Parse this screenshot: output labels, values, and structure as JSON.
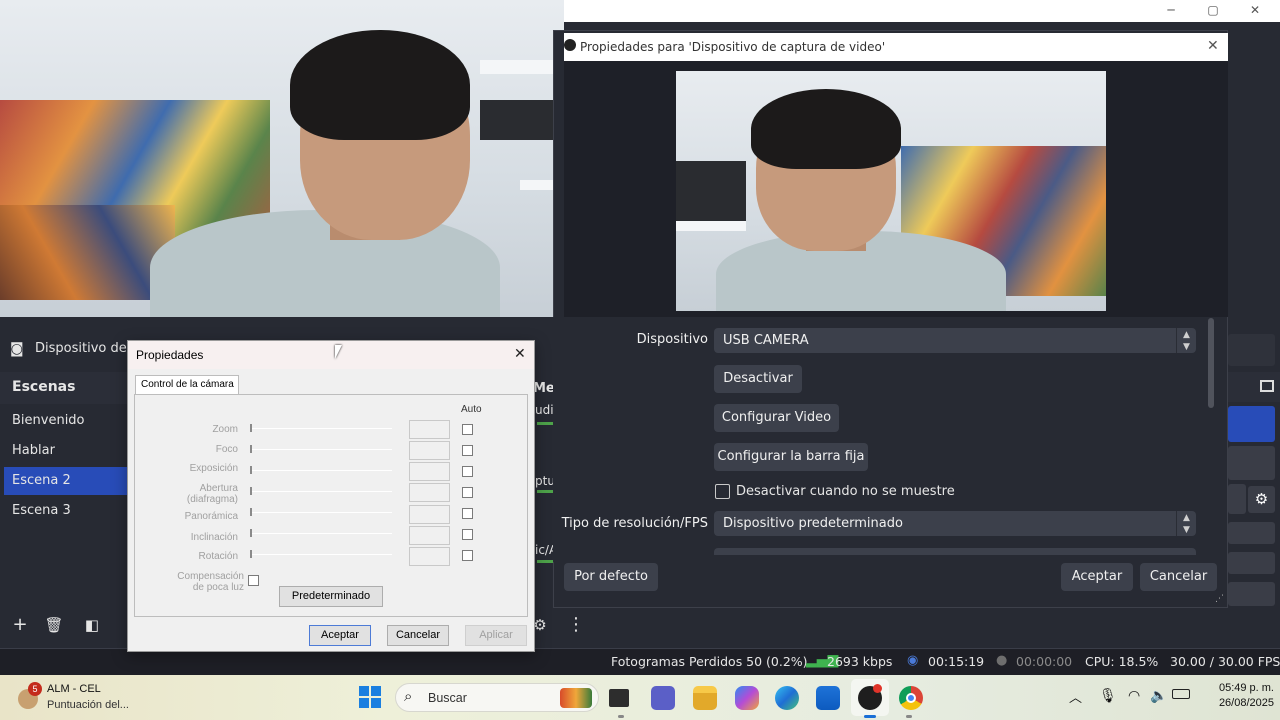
{
  "obs": {
    "source_bar_label": "Dispositivo de ca",
    "scenes_header": "Escenas",
    "scenes": [
      {
        "label": "Bienvenido",
        "active": false
      },
      {
        "label": "Hablar",
        "active": false
      },
      {
        "label": "Escena 2",
        "active": true
      },
      {
        "label": "Escena 3",
        "active": false
      }
    ],
    "mixer_fragments": [
      "Mez",
      "udio",
      "ptu",
      "ic/A"
    ],
    "status": {
      "dropped_frames": "Fotogramas Perdidos 50 (0.2%)",
      "bitrate": "2693 kbps",
      "stream_time": "00:15:19",
      "rec_time": "00:00:00",
      "cpu": "CPU: 18.5%",
      "fps": "30.00 / 30.00 FPS"
    },
    "accent_color": "#284cb8"
  },
  "props_dialog": {
    "title": "Propiedades para 'Dispositivo de captura de video'",
    "device_label": "Dispositivo",
    "device_value": "USB CAMERA",
    "deactivate_button": "Desactivar",
    "configure_video_button": "Configurar Video",
    "configure_crossbar_button": "Configurar la barra fija",
    "deactivate_when_hidden_label": "Desactivar cuando no se muestre",
    "deactivate_when_hidden_checked": false,
    "resolution_type_label": "Tipo de resolución/FPS",
    "resolution_type_value": "Dispositivo predeterminado",
    "defaults_button": "Por defecto",
    "accept_button": "Aceptar",
    "cancel_button": "Cancelar"
  },
  "win_dialog": {
    "title": "Propiedades",
    "tab": "Control de la cámara",
    "auto_header": "Auto",
    "rows": [
      {
        "label": "Zoom"
      },
      {
        "label": "Foco"
      },
      {
        "label": "Exposición"
      },
      {
        "label": "Abertura (diafragma)"
      },
      {
        "label": "Panorámica"
      },
      {
        "label": "Inclinación"
      },
      {
        "label": "Rotación"
      }
    ],
    "low_light_label": "Compensación de poca luz",
    "default_button": "Predeterminado",
    "accept_button": "Aceptar",
    "cancel_button": "Cancelar",
    "apply_button": "Aplicar"
  },
  "taskbar": {
    "notification": {
      "badge": "5",
      "title": "ALM - CEL",
      "subtitle": "Puntuación del..."
    },
    "search_placeholder": "Buscar",
    "time": "05:49 p. m.",
    "date": "26/08/2025",
    "pinned_icons": [
      "widgets-icon",
      "file-explorer-task-icon",
      "teams-icon",
      "folder-icon",
      "copilot-icon",
      "edge-icon",
      "store-icon",
      "obs-icon",
      "chrome-icon"
    ],
    "tray_icons": [
      "chevron-up-icon",
      "microphone-icon",
      "wifi-icon",
      "speaker-icon",
      "battery-icon"
    ]
  }
}
